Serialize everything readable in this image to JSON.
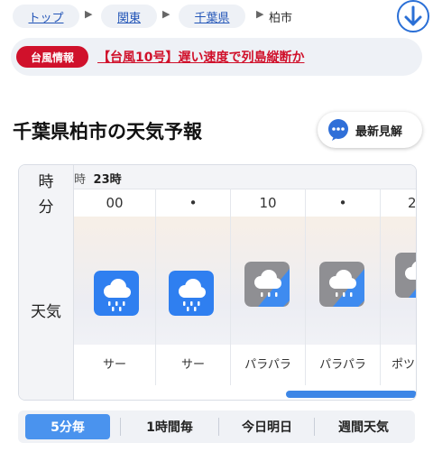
{
  "breadcrumb": {
    "items": [
      "トップ",
      "関東",
      "千葉県"
    ],
    "current": "柏市"
  },
  "typhoon_banner": {
    "badge": "台風情報",
    "text": "【台風10号】遅い速度で列島縦断か"
  },
  "page_title": "千葉県柏市の天気予報",
  "latest_button": {
    "label": "最新見解"
  },
  "forecast": {
    "row_labels": {
      "hour": "時",
      "minute": "分",
      "weather": "天気"
    },
    "hour_prefix": "時",
    "hour_value": "23時",
    "minutes": [
      "00",
      "•",
      "10",
      "•",
      "2"
    ],
    "descriptions": [
      "サー",
      "サー",
      "パラパラ",
      "パラパラ",
      "ポツ"
    ],
    "icons": [
      "rain-heavy-icon",
      "rain-heavy-icon",
      "rain-light-icon",
      "rain-light-icon",
      "rain-light-icon"
    ],
    "scroll_position": 0.62
  },
  "tabs": [
    {
      "label": "5分毎",
      "active": true
    },
    {
      "label": "1時間毎",
      "active": false
    },
    {
      "label": "今日明日",
      "active": false
    },
    {
      "label": "週間天気",
      "active": false
    }
  ],
  "colors": {
    "accent": "#4a93ee",
    "alert": "#d0112b",
    "link": "#2456b8",
    "rain_heavy_bg": "#2f7ff0",
    "rain_light_bg": "#8f8f93"
  }
}
